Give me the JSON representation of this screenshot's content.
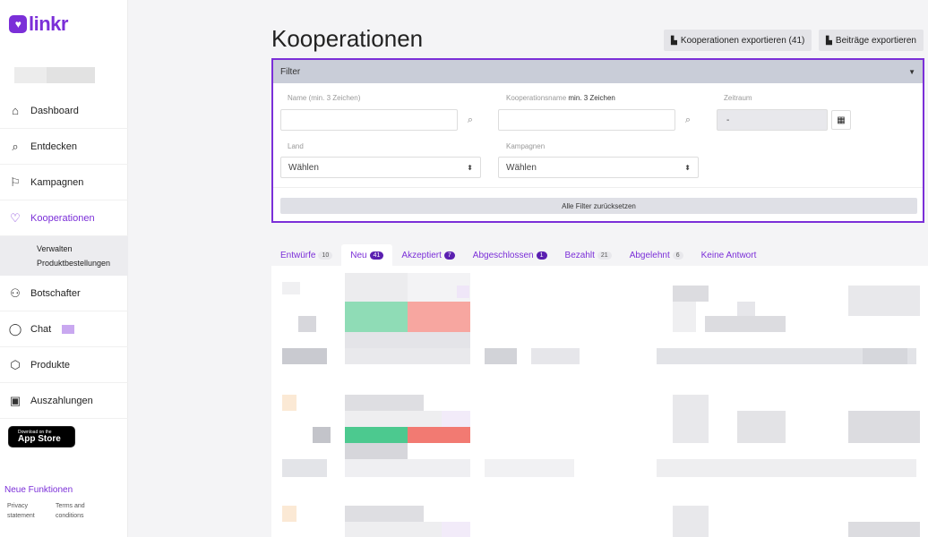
{
  "app": {
    "logo_text": "linkr"
  },
  "sidebar": {
    "items": [
      {
        "label": "Dashboard",
        "icon": "home-icon"
      },
      {
        "label": "Entdecken",
        "icon": "search-icon"
      },
      {
        "label": "Kampagnen",
        "icon": "flag-icon"
      },
      {
        "label": "Kooperationen",
        "icon": "heart-icon"
      },
      {
        "label": "Botschafter",
        "icon": "users-icon"
      },
      {
        "label": "Chat",
        "icon": "chat-icon"
      },
      {
        "label": "Produkte",
        "icon": "box-icon"
      },
      {
        "label": "Auszahlungen",
        "icon": "wallet-icon"
      }
    ],
    "sub_items": [
      "Verwalten",
      "Produktbestellungen"
    ],
    "appstore": {
      "small": "Download on the",
      "big": "App Store"
    },
    "neue_funktionen": "Neue Funktionen",
    "privacy": "Privacy statement",
    "terms": "Terms and conditions"
  },
  "header": {
    "title": "Kooperationen",
    "export_koops": "Kooperationen exportieren (41)",
    "export_beitraege": "Beiträge exportieren"
  },
  "filter": {
    "title": "Filter",
    "name_label": "Name (min. 3 Zeichen)",
    "koop_label_a": "Kooperationsname",
    "koop_label_b": "min. 3 Zeichen",
    "zeitraum_label": "Zeitraum",
    "zeitraum_value": "-",
    "land_label": "Land",
    "land_value": "Wählen",
    "kampagnen_label": "Kampagnen",
    "kampagnen_value": "Wählen",
    "reset": "Alle Filter zurücksetzen"
  },
  "tabs": [
    {
      "label": "Entwürfe",
      "count": "10",
      "dark": false
    },
    {
      "label": "Neu",
      "count": "41",
      "dark": true
    },
    {
      "label": "Akzeptiert",
      "count": "7",
      "dark": true
    },
    {
      "label": "Abgeschlossen",
      "count": "1",
      "dark": true
    },
    {
      "label": "Bezahlt",
      "count": "21",
      "dark": false
    },
    {
      "label": "Abgelehnt",
      "count": "6",
      "dark": false
    },
    {
      "label": "Keine Antwort",
      "count": "",
      "dark": false
    }
  ],
  "colors": {
    "accent": "#7b2fd8",
    "green": "#4cc98f",
    "red": "#f27a72"
  }
}
